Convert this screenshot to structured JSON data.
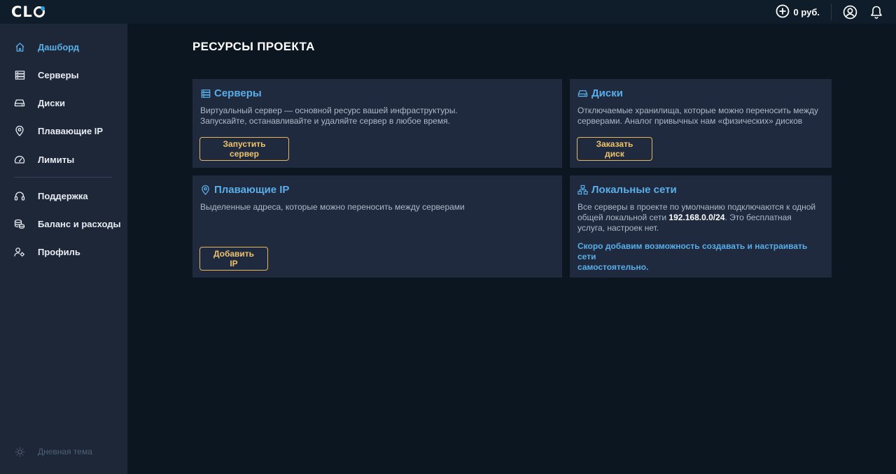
{
  "brand": {
    "logo_text": "CL"
  },
  "header": {
    "balance": "0 руб."
  },
  "sidebar": {
    "items": [
      {
        "label": "Дашборд",
        "icon": "home-icon",
        "active": true
      },
      {
        "label": "Серверы",
        "icon": "server-icon"
      },
      {
        "label": "Диски",
        "icon": "disk-icon"
      },
      {
        "label": "Плавающие IP",
        "icon": "location-pin-icon"
      },
      {
        "label": "Лимиты",
        "icon": "gauge-icon"
      },
      {
        "label": "Поддержка",
        "icon": "headset-icon"
      },
      {
        "label": "Баланс и расходы",
        "icon": "coins-icon"
      },
      {
        "label": "Профиль",
        "icon": "user-settings-icon"
      }
    ],
    "theme_toggle": "Дневная тема"
  },
  "main": {
    "title": "РЕСУРСЫ ПРОЕКТА",
    "cards": {
      "servers": {
        "title": "Серверы",
        "desc_line1": "Виртуальный сервер — основной ресурс вашей инфраструктуры.",
        "desc_line2": "Запускайте, останавливайте и удаляйте сервер в любое время.",
        "button": "Запустить сервер"
      },
      "disks": {
        "title": "Диски",
        "desc_line1": "Отключаемые хранилища, которые можно переносить между",
        "desc_line2": "серверами. Аналог привычных нам «физических» дисков",
        "button": "Заказать диск"
      },
      "floating_ip": {
        "title": "Плавающие IP",
        "desc": "Выделенные адреса, которые можно переносить между серверами",
        "button": "Добавить IP"
      },
      "networks": {
        "title": "Локальные сети",
        "desc_line1": "Все серверы в проекте по умолчанию подключаются к одной",
        "desc_part2": "общей локальной сети ",
        "desc_ip": "192.168.0.0/24",
        "desc_part3": ". Это бесплатная",
        "desc_line3": "услуга, настроек нет.",
        "note_line1": "Скоро добавим возможность создавать и настраивать сети",
        "note_line2": "самостоятельно."
      }
    }
  },
  "colors": {
    "accent": "#5aaee8",
    "button": "#e6b75c",
    "sidebar": "#1d2738",
    "card": "#1f2a3f",
    "background": "#0b1620"
  }
}
